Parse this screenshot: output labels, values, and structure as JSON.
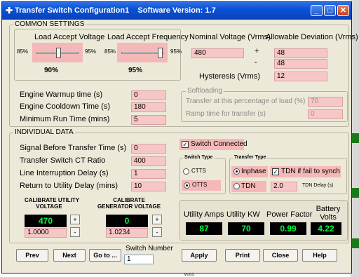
{
  "window": {
    "title": "Transfer Switch Configuration1",
    "version": "Software Version: 1.7",
    "controls": [
      "minimize-icon",
      "maximize-icon",
      "close-icon"
    ]
  },
  "common": {
    "title": "COMMON SETTINGS",
    "load_accept_voltage": {
      "label": "Load Accept Voltage",
      "min": "85%",
      "max": "95%",
      "value": "90%",
      "level": 0.5
    },
    "load_accept_frequency": {
      "label": "Load Accept Frequency",
      "min": "85%",
      "max": "95%",
      "value": "95%",
      "level": 1.0
    },
    "nominal_voltage": {
      "label": "Nominal Voltage (Vrms)",
      "value": "480"
    },
    "allowable_deviation": {
      "label": "Allowable Deviation (Vrms)",
      "plus_sign": "+",
      "minus_sign": "-",
      "plus_value": "48",
      "minus_value": "48"
    },
    "hysteresis": {
      "label": "Hysteresis (Vrms)",
      "value": "12"
    },
    "warmup": {
      "label": "Engine Warmup time (s)",
      "value": "0"
    },
    "cooldown": {
      "label": "Engine Cooldown Time (s)",
      "value": "180"
    },
    "min_run": {
      "label": "Minimum Run Time (mins)",
      "value": "5"
    },
    "softloading": {
      "title": "Softloading",
      "transfer_pct_label": "Transfer at this percentage of load (%)",
      "transfer_pct_value": "70",
      "ramp_label": "Ramp time for transfer (s)",
      "ramp_value": "0"
    }
  },
  "individual": {
    "title": "INDIVIDUAL DATA",
    "signal_before": {
      "label": "Signal Before Transfer Time (s)",
      "value": "0"
    },
    "ct_ratio": {
      "label": "Transfer Switch CT Ratio",
      "value": "400"
    },
    "line_interruption": {
      "label": "Line Interruption Delay (s)",
      "value": "1"
    },
    "return_delay": {
      "label": "Return to Utility Delay (mins)",
      "value": "10"
    },
    "switch_connected": {
      "label": "Switch Connected",
      "checked": true
    },
    "switch_type": {
      "title": "Switch Type",
      "options": [
        "CTTS",
        "OTTS"
      ],
      "selected": "OTTS"
    },
    "transfer_type": {
      "title": "Transfer Type",
      "options": [
        "Inphase",
        "TDN"
      ],
      "selected": "Inphase",
      "tdn_fail_label": "TDN if fail to synch",
      "tdn_fail_checked": true,
      "tdn_delay_value": "2.0",
      "tdn_delay_label": "TDN Delay (s)"
    },
    "cal_utility": {
      "title_line1": "CALIBRATE UTILITY",
      "title_line2": "VOLTAGE",
      "display": "470",
      "factor": "1.0000"
    },
    "cal_generator": {
      "title_line1": "CALIBRATE",
      "title_line2": "GENERATOR VOLTAGE",
      "display": "0",
      "factor": "1.0234"
    },
    "stepper": {
      "plus": "+",
      "minus": "-"
    },
    "meters": [
      {
        "label": "Utility Amps",
        "value": "87"
      },
      {
        "label": "Utility KW",
        "value": "70"
      },
      {
        "label": "Power Factor",
        "value": "0.99"
      },
      {
        "label_line1": "Battery",
        "label_line2": "Volts",
        "value": "4.22"
      }
    ]
  },
  "footer": {
    "prev": "Prev",
    "next": "Next",
    "goto": "Go to ...",
    "switch_number_label": "Switch Number",
    "switch_number_value": "1",
    "apply": "Apply",
    "print": "Print",
    "close": "Close",
    "help": "Help"
  },
  "background_text": "Volts"
}
